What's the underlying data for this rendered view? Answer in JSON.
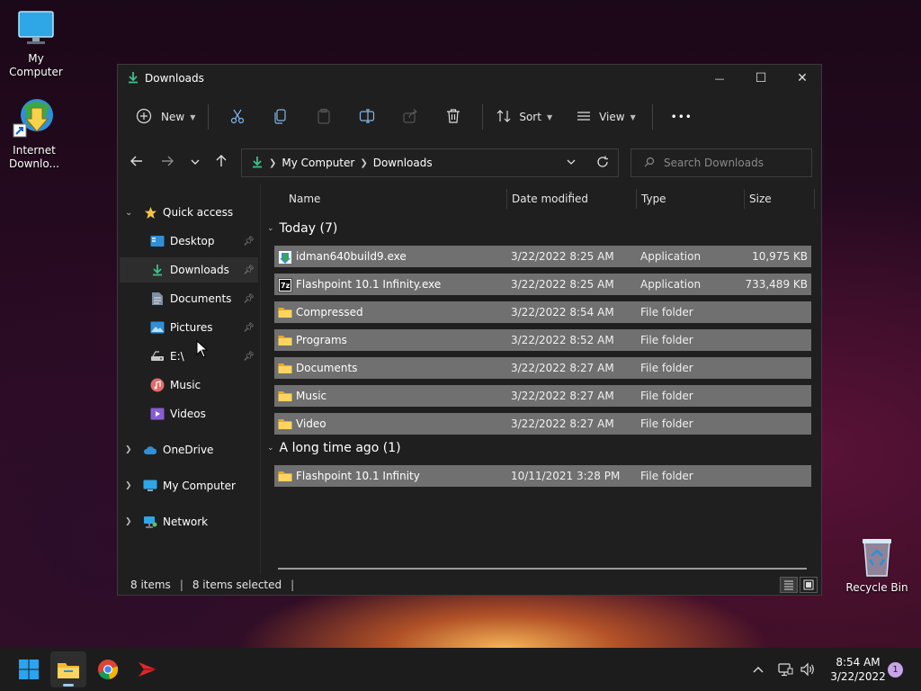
{
  "desktop": {
    "icons": [
      {
        "label": "My Computer",
        "icon": "monitor-icon"
      },
      {
        "label": "Internet Downlo...",
        "icon": "idm-icon"
      },
      {
        "label": "Recycle Bin",
        "icon": "recycle-bin-icon"
      }
    ]
  },
  "window": {
    "title": "Downloads",
    "controls": {
      "minimize": "—",
      "maximize": "☐",
      "close": "✕"
    }
  },
  "toolbar": {
    "new_label": "New",
    "sort_label": "Sort",
    "view_label": "View",
    "more_label": "•••"
  },
  "navigation": {
    "breadcrumb": [
      "My Computer",
      "Downloads"
    ],
    "search_placeholder": "Search Downloads"
  },
  "sidebar": {
    "quick_access": "Quick access",
    "quick_items": [
      {
        "label": "Desktop",
        "pinned": true
      },
      {
        "label": "Downloads",
        "pinned": true,
        "active": true
      },
      {
        "label": "Documents",
        "pinned": true
      },
      {
        "label": "Pictures",
        "pinned": true
      },
      {
        "label": "E:\\",
        "pinned": true
      },
      {
        "label": "Music",
        "pinned": false
      },
      {
        "label": "Videos",
        "pinned": false
      }
    ],
    "roots": [
      {
        "label": "OneDrive"
      },
      {
        "label": "My Computer"
      },
      {
        "label": "Network"
      }
    ]
  },
  "columns": {
    "name": "Name",
    "date": "Date modified",
    "type": "Type",
    "size": "Size"
  },
  "groups": [
    {
      "label": "Today (7)",
      "files": [
        {
          "name": "idman640build9.exe",
          "date": "3/22/2022 8:25 AM",
          "type": "Application",
          "size": "10,975 KB",
          "icon": "idm-exe-icon"
        },
        {
          "name": "Flashpoint 10.1 Infinity.exe",
          "date": "3/22/2022 8:25 AM",
          "type": "Application",
          "size": "733,489 KB",
          "icon": "7zip-exe-icon"
        },
        {
          "name": "Compressed",
          "date": "3/22/2022 8:54 AM",
          "type": "File folder",
          "size": "",
          "icon": "folder-icon"
        },
        {
          "name": "Programs",
          "date": "3/22/2022 8:52 AM",
          "type": "File folder",
          "size": "",
          "icon": "folder-icon"
        },
        {
          "name": "Documents",
          "date": "3/22/2022 8:27 AM",
          "type": "File folder",
          "size": "",
          "icon": "folder-icon"
        },
        {
          "name": "Music",
          "date": "3/22/2022 8:27 AM",
          "type": "File folder",
          "size": "",
          "icon": "folder-icon"
        },
        {
          "name": "Video",
          "date": "3/22/2022 8:27 AM",
          "type": "File folder",
          "size": "",
          "icon": "folder-icon"
        }
      ]
    },
    {
      "label": "A long time ago (1)",
      "files": [
        {
          "name": "Flashpoint 10.1 Infinity",
          "date": "10/11/2021 3:28 PM",
          "type": "File folder",
          "size": "",
          "icon": "folder-icon"
        }
      ]
    }
  ],
  "status": {
    "items": "8 items",
    "selected": "8 items selected"
  },
  "taskbar": {
    "time": "8:54 AM",
    "date": "3/22/2022",
    "notification_count": "1"
  },
  "colors": {
    "accent": "#0078d4",
    "folder": "#f5c542",
    "selection": "#707070"
  }
}
